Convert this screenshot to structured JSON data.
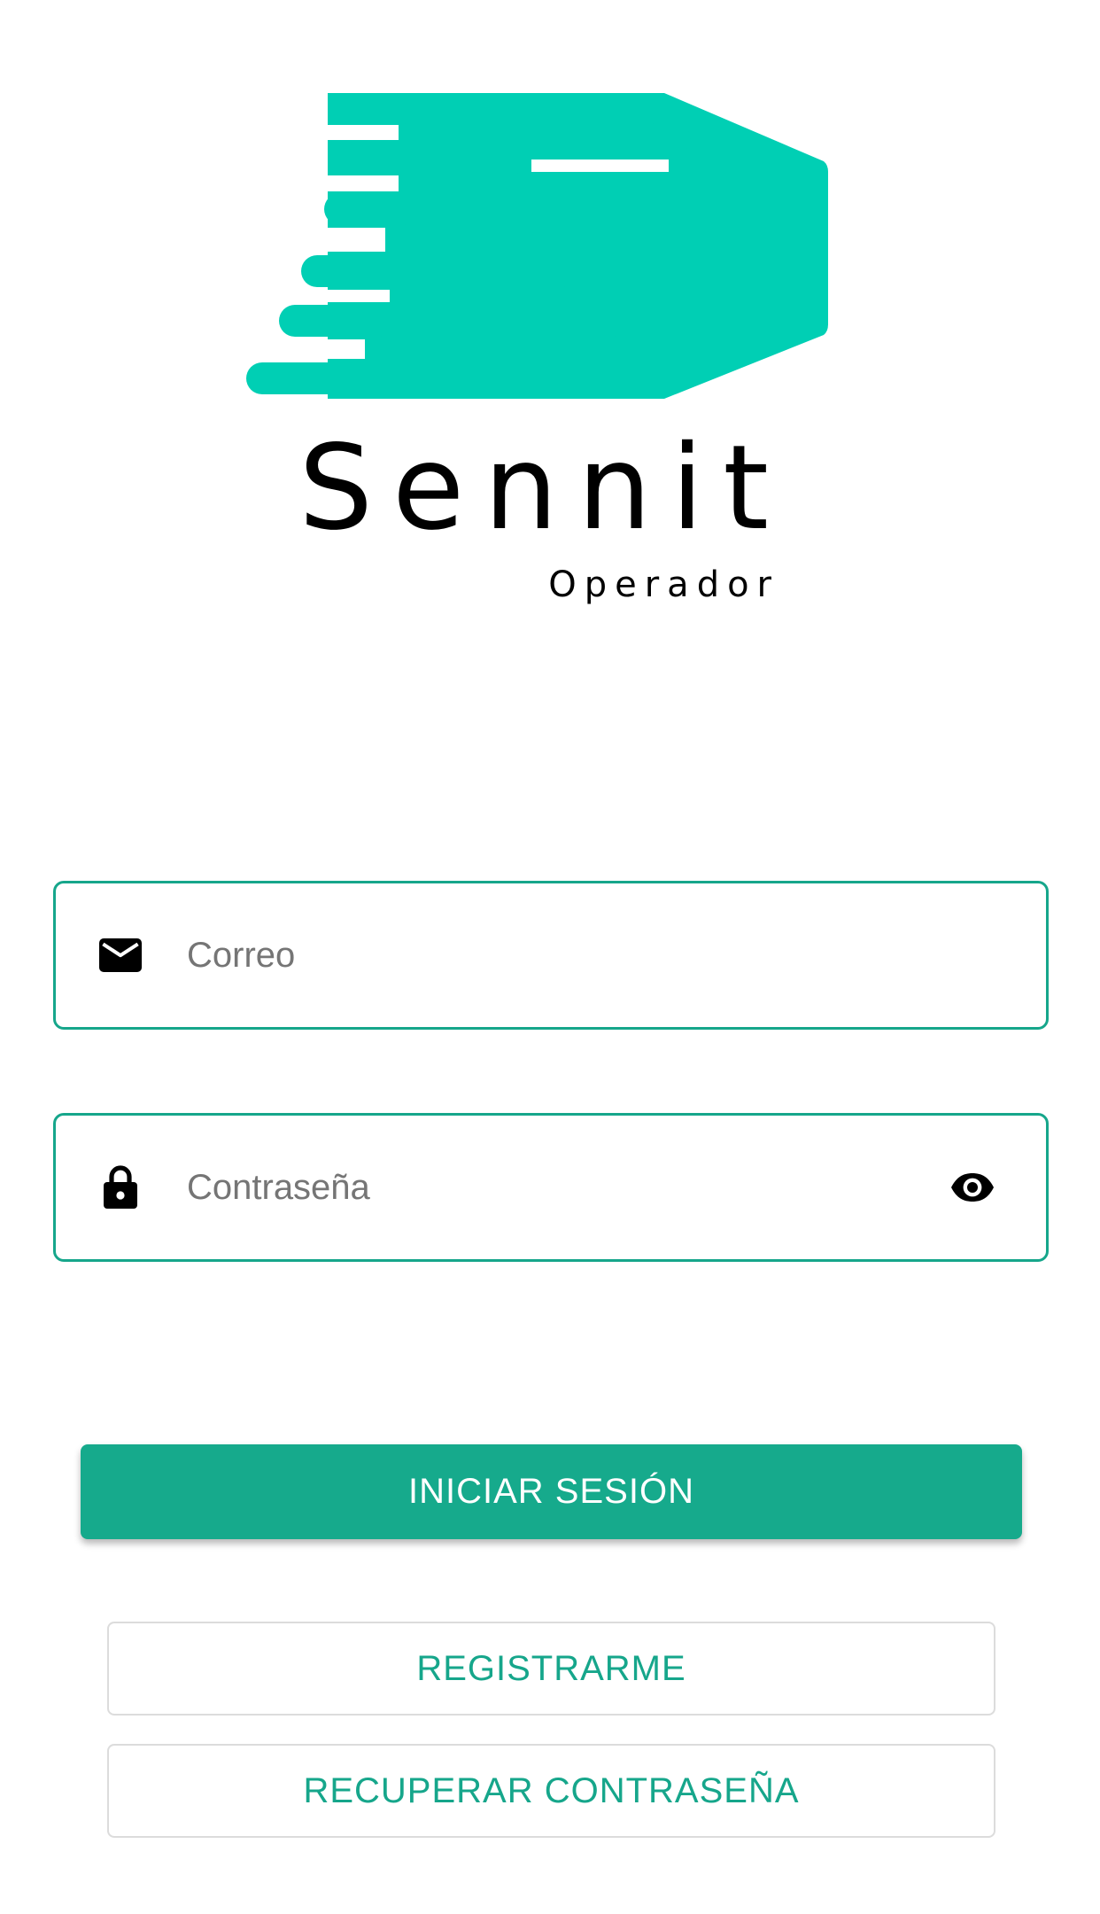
{
  "brand": {
    "name": "Sennit",
    "subtitle": "Operador",
    "accent_color": "#00cfb4"
  },
  "login_form": {
    "email": {
      "icon": "mail-icon",
      "placeholder": "Correo",
      "value": ""
    },
    "password": {
      "icon": "lock-icon",
      "placeholder": "Contraseña",
      "value": "",
      "toggle_icon": "eye-icon"
    }
  },
  "actions": {
    "login_label": "INICIAR SESIÓN",
    "register_label": "REGISTRARME",
    "recover_label": "RECUPERAR CONTRASEÑA"
  },
  "colors": {
    "primary": "#16aa8c",
    "field_border": "#16a68b",
    "logo": "#00cfb4"
  }
}
